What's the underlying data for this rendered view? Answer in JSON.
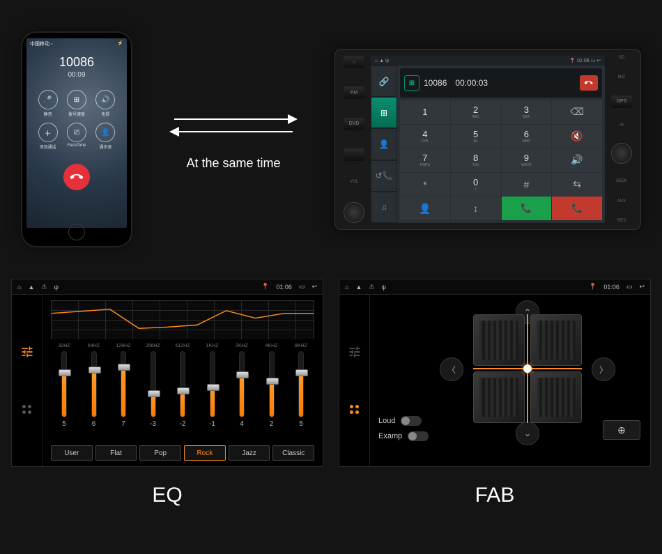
{
  "top": {
    "caption": "At the same time",
    "phone": {
      "status_left": "中国移动 ◦",
      "status_right": "⚡",
      "number": "10086",
      "duration": "00:09",
      "actions": [
        "静音",
        "拨号键盘",
        "免提",
        "添加通话",
        "FaceTime",
        "通讯录"
      ]
    },
    "headunit": {
      "side_left": [
        "⌂",
        "FM",
        "DVD",
        "",
        "VOL"
      ],
      "side_right_labels": [
        "SD",
        "MIC",
        "GPS",
        "IR",
        "SEEK",
        "AUX",
        "RES"
      ],
      "status_right": "01:06",
      "nav_icons": [
        "link",
        "grid",
        "person",
        "phone-missed",
        "music"
      ],
      "display_number": "10086",
      "display_duration": "00:00:03",
      "keypad": [
        {
          "main": "1",
          "sub": ""
        },
        {
          "main": "2",
          "sub": "ABC"
        },
        {
          "main": "3",
          "sub": "DEF"
        },
        {
          "main": "⌫",
          "sub": ""
        },
        {
          "main": "4",
          "sub": "GHI"
        },
        {
          "main": "5",
          "sub": "JKL"
        },
        {
          "main": "6",
          "sub": "MNO"
        },
        {
          "main": "🔇",
          "sub": ""
        },
        {
          "main": "7",
          "sub": "PQRS"
        },
        {
          "main": "8",
          "sub": "TUV"
        },
        {
          "main": "9",
          "sub": "WXYZ"
        },
        {
          "main": "🔊",
          "sub": ""
        },
        {
          "main": "*",
          "sub": ""
        },
        {
          "main": "0",
          "sub": "+"
        },
        {
          "main": "#",
          "sub": ""
        },
        {
          "main": "⇆",
          "sub": ""
        },
        {
          "main": "👤",
          "sub": ""
        },
        {
          "main": "↕",
          "sub": ""
        },
        {
          "main": "📞",
          "sub": ""
        },
        {
          "main": "📞",
          "sub": ""
        }
      ]
    }
  },
  "status_bar": {
    "time": "01:06",
    "icons_left": [
      "⌂",
      "▲",
      "⚠",
      "ψ"
    ],
    "icons_right": [
      "📍",
      "01:06",
      "▭",
      "↩"
    ]
  },
  "eq": {
    "title": "EQ",
    "freqs": [
      "32HZ",
      "64HZ",
      "128HZ",
      "256HZ",
      "512HZ",
      "1KHZ",
      "2KHZ",
      "4KHZ",
      "8KHZ"
    ],
    "values": [
      5,
      6,
      7,
      -3,
      -2,
      -1,
      4,
      2,
      5
    ],
    "fills": [
      68,
      72,
      76,
      35,
      40,
      45,
      64,
      55,
      68
    ],
    "presets": [
      "User",
      "Flat",
      "Pop",
      "Rock",
      "Jazz",
      "Classic"
    ],
    "active_preset": 3
  },
  "fab": {
    "title": "FAB",
    "toggles": [
      {
        "label": "Loud",
        "on": false
      },
      {
        "label": "Examp",
        "on": false
      }
    ]
  }
}
